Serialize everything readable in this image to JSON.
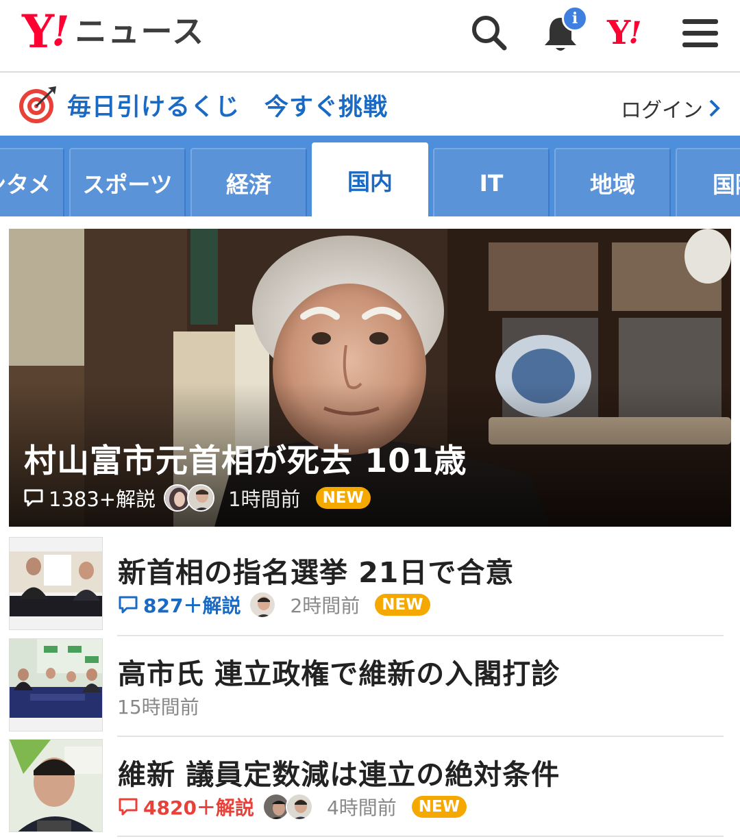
{
  "header": {
    "logo_y": "Y",
    "logo_bang": "!",
    "logo_text": "ニュース",
    "notification_badge": "i",
    "yahoo_y": "Y",
    "yahoo_bang": "!",
    "icons": [
      "search-icon",
      "bell-icon",
      "menu-icon"
    ]
  },
  "promo": {
    "text1": "毎日引けるくじ",
    "text2": "今すぐ挑戦",
    "login": "ログイン"
  },
  "tabs": [
    {
      "label": "ンタメ"
    },
    {
      "label": "スポーツ"
    },
    {
      "label": "経済"
    },
    {
      "label": "国内",
      "active": true
    },
    {
      "label": "IT"
    },
    {
      "label": "地域"
    },
    {
      "label": "国際"
    }
  ],
  "hero": {
    "title": "村山富市元首相が死去 101歳",
    "comments": "1383+解説",
    "time": "1時間前",
    "badge": "NEW"
  },
  "articles": [
    {
      "title": "新首相の指名選挙 21日で合意",
      "comments": "827＋解説",
      "time": "2時間前",
      "badge": "NEW"
    },
    {
      "title": "高市氏 連立政権で維新の入閣打診",
      "time": "15時間前"
    },
    {
      "title": "維新 議員定数減は連立の絶対条件",
      "comments": "4820＋解説",
      "time": "4時間前",
      "badge": "NEW"
    }
  ],
  "colors": {
    "brand_red": "#ff0033",
    "link_blue": "#1a6ac4",
    "tab_blue": "#4d8fdb",
    "new_badge": "#f5a800",
    "hot_comment_red": "#e8413a"
  }
}
